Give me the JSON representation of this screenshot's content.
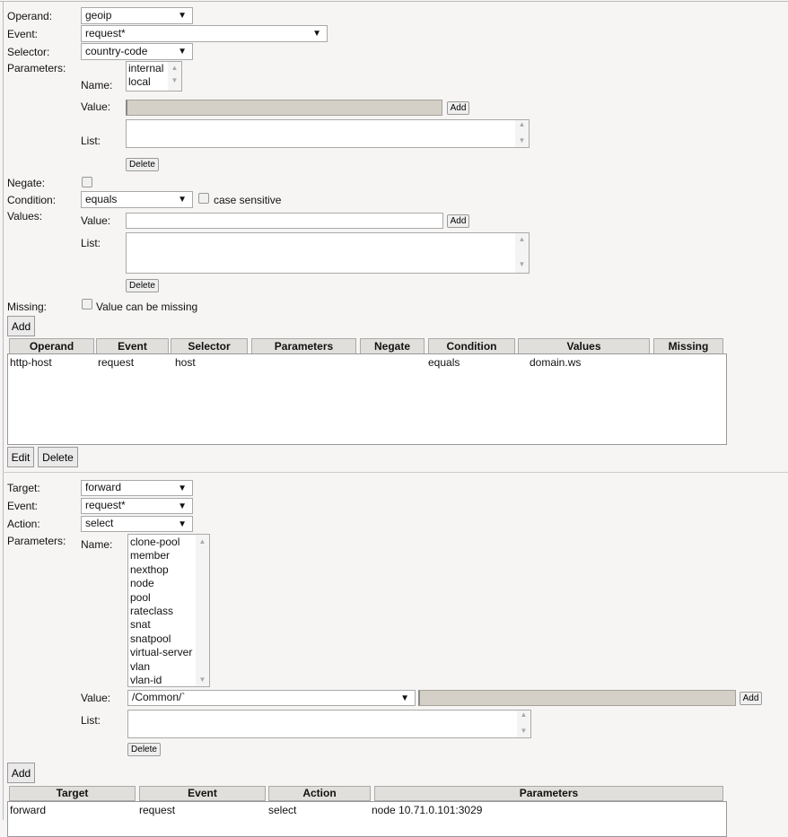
{
  "conditions": {
    "operand_label": "Operand:",
    "operand_value": "geoip",
    "event_label": "Event:",
    "event_value": "request*",
    "selector_label": "Selector:",
    "selector_value": "country-code",
    "parameters_label": "Parameters:",
    "name_label": "Name:",
    "name_options": [
      "internal",
      "local"
    ],
    "value_label": "Value:",
    "add_label": "Add",
    "list_label": "List:",
    "delete_label": "Delete",
    "negate_label": "Negate:",
    "negate_checked": false,
    "condition_label": "Condition:",
    "condition_value": "equals",
    "case_sensitive_label": "case sensitive",
    "case_sensitive_checked": false,
    "values_label": "Values:",
    "values_value_label": "Value:",
    "values_value": "",
    "values_add_label": "Add",
    "values_list_label": "List:",
    "values_delete_label": "Delete",
    "missing_label": "Missing:",
    "missing_checkbox_label": "Value can be missing",
    "missing_checked": false,
    "add_button": "Add",
    "table": {
      "headers": [
        "Operand",
        "Event",
        "Selector",
        "Parameters",
        "Negate",
        "Condition",
        "Values",
        "Missing"
      ],
      "rows": [
        [
          "http-host",
          "request",
          "host",
          "",
          "",
          "equals",
          "domain.ws",
          ""
        ]
      ]
    },
    "edit_button": "Edit",
    "delete_button": "Delete"
  },
  "actions": {
    "target_label": "Target:",
    "target_value": "forward",
    "event_label": "Event:",
    "event_value": "request*",
    "action_label": "Action:",
    "action_value": "select",
    "parameters_label": "Parameters:",
    "name_label": "Name:",
    "name_options": [
      "clone-pool",
      "member",
      "nexthop",
      "node",
      "pool",
      "rateclass",
      "snat",
      "snatpool",
      "virtual-server",
      "vlan",
      "vlan-id"
    ],
    "value_label": "Value:",
    "value_select": "/Common/`",
    "add_label": "Add",
    "list_label": "List:",
    "delete_label": "Delete",
    "add_button": "Add",
    "table": {
      "headers": [
        "Target",
        "Event",
        "Action",
        "Parameters"
      ],
      "rows": [
        [
          "forward",
          "request",
          "select",
          "node 10.71.0.101:3029"
        ]
      ]
    }
  }
}
